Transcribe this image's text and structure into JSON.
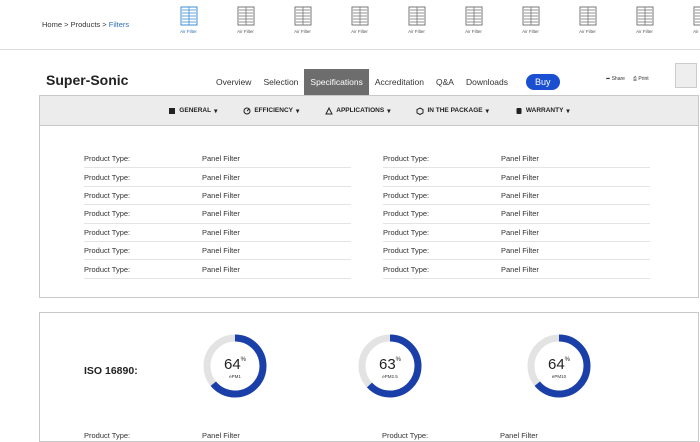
{
  "breadcrumb": {
    "home": "Home",
    "sep1": " > ",
    "products": "Products",
    "sep2": " > ",
    "current": "Filters"
  },
  "thumbnails": [
    "Air Filter",
    "Air Filter",
    "Air Filter",
    "Air Filter",
    "Air Filter",
    "Air Filter",
    "Air Filter",
    "Air Filter",
    "Air Filter",
    "Air Filter"
  ],
  "product": {
    "title": "Super-Sonic"
  },
  "nav": {
    "items": [
      "Overview",
      "Selection",
      "Specifications",
      "Accreditation",
      "Q&A",
      "Downloads"
    ],
    "active": "Specifications",
    "buy": "Buy"
  },
  "actions": {
    "share": "Share",
    "print": "Print"
  },
  "spec_tabs": [
    "GENERAL",
    "EFFICIENCY",
    "APPLICATIONS",
    "IN THE PACKAGE",
    "WARRANTY"
  ],
  "specs": {
    "left": [
      {
        "k": "Product Type:",
        "v": "Panel Filter"
      },
      {
        "k": "Product Type:",
        "v": "Panel Filter"
      },
      {
        "k": "Product Type:",
        "v": "Panel Filter"
      },
      {
        "k": "Product Type:",
        "v": "Panel Filter"
      },
      {
        "k": "Product Type:",
        "v": "Panel Filter"
      },
      {
        "k": "Product Type:",
        "v": "Panel Filter"
      },
      {
        "k": "Product Type:",
        "v": "Panel Filter"
      }
    ],
    "right": [
      {
        "k": "Product Type:",
        "v": "Panel Filter"
      },
      {
        "k": "Product Type:",
        "v": "Panel Filter"
      },
      {
        "k": "Product Type:",
        "v": "Panel Filter"
      },
      {
        "k": "Product Type:",
        "v": "Panel Filter"
      },
      {
        "k": "Product Type:",
        "v": "Panel Filter"
      },
      {
        "k": "Product Type:",
        "v": "Panel Filter"
      },
      {
        "k": "Product Type:",
        "v": "Panel Filter"
      }
    ]
  },
  "efficiency": {
    "label": "ISO 16890:",
    "gauges": [
      {
        "value": "64",
        "unit": "%",
        "sub": "ePM1",
        "fraction": 0.64
      },
      {
        "value": "63",
        "unit": "%",
        "sub": "ePM2.5",
        "fraction": 0.63
      },
      {
        "value": "64",
        "unit": "%",
        "sub": "ePM10",
        "fraction": 0.64
      }
    ],
    "partial_row": {
      "k1": "Product Type:",
      "v1": "Panel Filter",
      "k2": "Product Type:",
      "v2": "Panel Filter"
    }
  },
  "colors": {
    "accent": "#1a3fa8",
    "buy": "#1a4fd1",
    "active_tab": "#6d6d6d",
    "link": "#2f6fb4",
    "gauge_track": "#e3e3e3"
  }
}
